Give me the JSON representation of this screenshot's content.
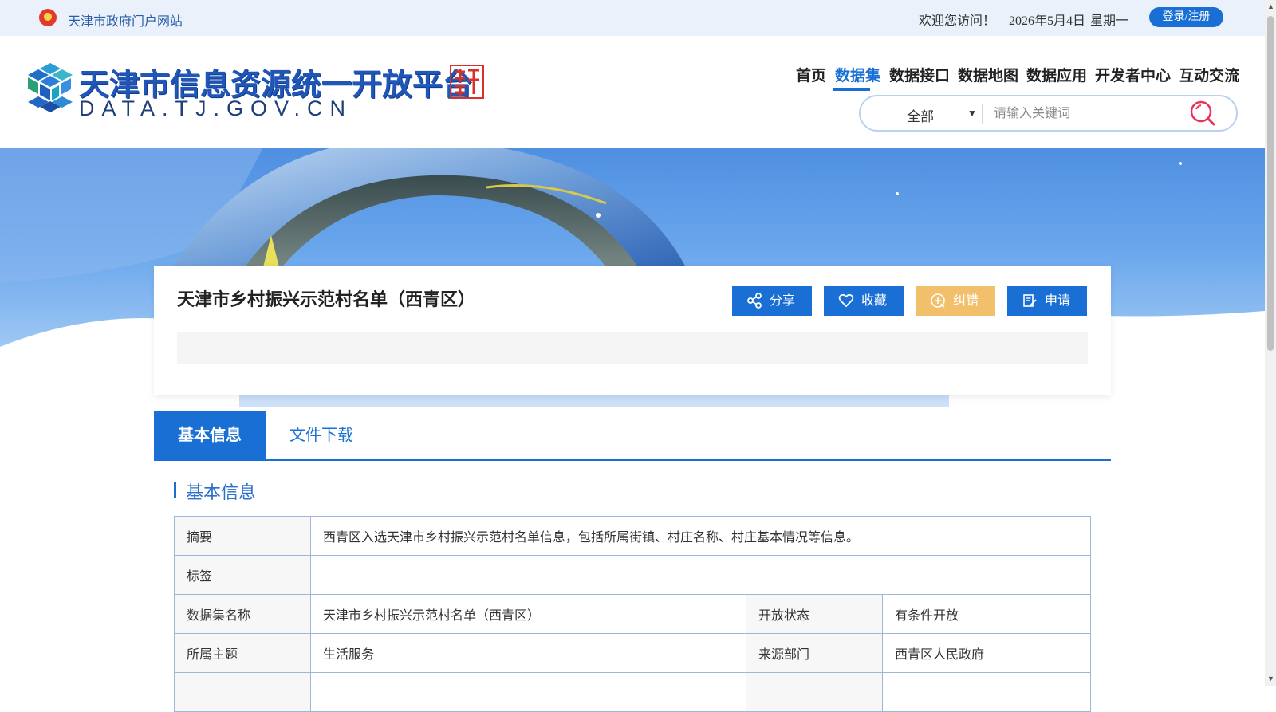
{
  "topbar": {
    "gov_portal": "天津市政府门户网站",
    "welcome": "欢迎您访问！",
    "date": "2026年5月4日",
    "weekday": "星期一",
    "login": "登录/注册"
  },
  "header": {
    "logo_title": "天津市信息资源统一开放平台",
    "logo_domain": "DATA.TJ.GOV.CN",
    "nav": [
      "首页",
      "数据集",
      "数据接口",
      "数据地图",
      "数据应用",
      "开发者中心",
      "互动交流"
    ],
    "active_nav": "数据集",
    "search": {
      "scope": "全部",
      "placeholder": "请输入关键词"
    }
  },
  "dataset": {
    "title": "天津市乡村振兴示范村名单（西青区）",
    "actions": {
      "share": "分享",
      "favorite": "收藏",
      "report": "纠错",
      "apply": "申请"
    }
  },
  "tabs": {
    "basic": "基本信息",
    "files": "文件下载"
  },
  "section": {
    "title": "基本信息"
  },
  "info": {
    "summary_label": "摘要",
    "summary_value": "西青区入选天津市乡村振兴示范村名单信息，包括所属街镇、村庄名称、村庄基本情况等信息。",
    "tags_label": "标签",
    "tags_value": "",
    "name_label": "数据集名称",
    "name_value": "天津市乡村振兴示范村名单（西青区）",
    "open_status_label": "开放状态",
    "open_status_value": "有条件开放",
    "theme_label": "所属主题",
    "theme_value": "生活服务",
    "source_label": "来源部门",
    "source_value": "西青区人民政府"
  },
  "colors": {
    "primary": "#1a6fd4",
    "report_button": "#f2c06a",
    "topbar_bg": "#eaf1fa"
  }
}
